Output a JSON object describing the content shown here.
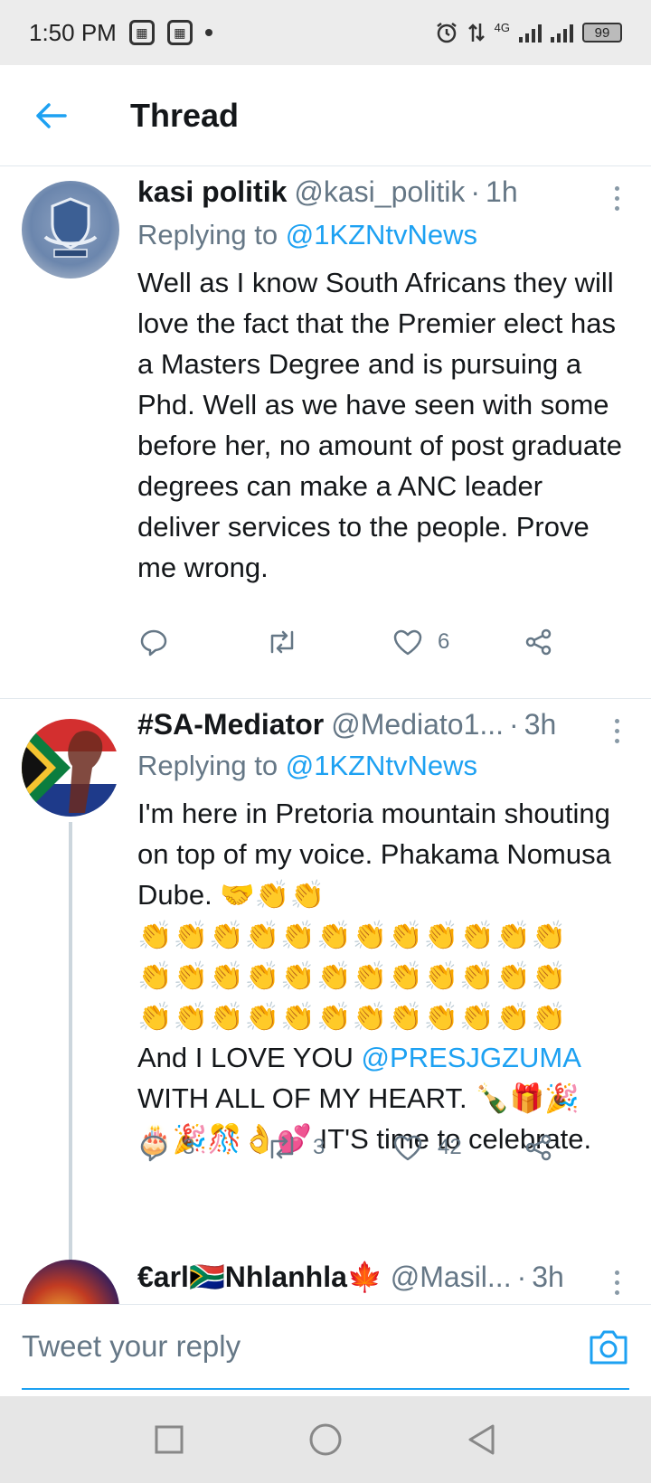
{
  "status_bar": {
    "time": "1:50 PM",
    "network": "4G",
    "battery": "99"
  },
  "header": {
    "title": "Thread"
  },
  "tweets": [
    {
      "name": "kasi politik",
      "handle": "@kasi_politik",
      "separator": "·",
      "time": "1h",
      "replying_label": "Replying to",
      "replying_to": "@1KZNtvNews",
      "text": "Well as I know South Africans they will love the fact that the Premier elect has a Masters Degree and is pursuing a Phd. Well as we have seen with some before her, no amount of post graduate degrees can make a ANC leader deliver services to the people. Prove me wrong.",
      "reply_count": "",
      "retweet_count": "",
      "like_count": "6"
    },
    {
      "name": "#SA-Mediator",
      "handle": "@Mediato1...",
      "separator": "·",
      "time": "3h",
      "replying_label": "Replying to",
      "replying_to": "@1KZNtvNews",
      "text_part1": "I'm here in Pretoria mountain shouting on top of my voice. Phakama Nomusa Dube. 🤝👏👏",
      "emoji_row1": "👏👏👏👏👏👏👏👏👏👏👏👏",
      "emoji_row2": "👏👏👏👏👏👏👏👏👏👏👏👏",
      "emoji_row3": "👏👏👏👏👏👏👏👏👏👏👏👏",
      "text_part2": "And I LOVE YOU ",
      "mention": "@PRESJGZUMA",
      "text_part3": " WITH ALL OF MY HEART. 🍾🎁🎉",
      "text_part4": "🎂🎉🎊👌💕 IT'S time to celebrate.",
      "reply_count": "3",
      "retweet_count": "3",
      "like_count": "42"
    },
    {
      "name": "€arl🇿🇦Nhlanhla🍁",
      "handle": "@Masil...",
      "separator": "·",
      "time": "3h"
    }
  ],
  "reply_bar": {
    "placeholder": "Tweet your reply"
  },
  "icons": {
    "accent": "#1da1f2",
    "secondary": "#657786"
  }
}
